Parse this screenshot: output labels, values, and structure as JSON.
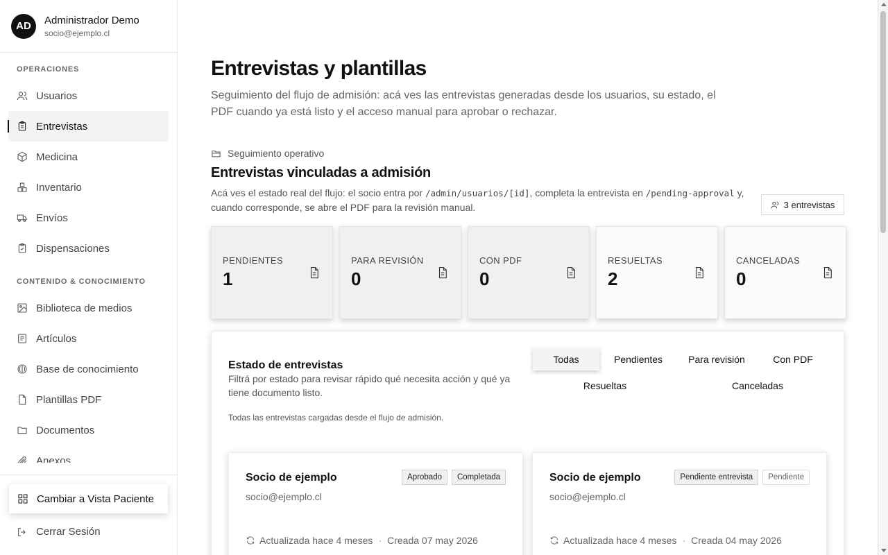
{
  "user": {
    "initials": "AD",
    "name": "Administrador Demo",
    "email": "socio@ejemplo.cl"
  },
  "sidebar": {
    "sections": [
      {
        "title": "OPERACIONES",
        "items": [
          {
            "label": "Usuarios",
            "icon": "users-icon"
          },
          {
            "label": "Entrevistas",
            "icon": "clipboard-icon",
            "active": true
          },
          {
            "label": "Medicina",
            "icon": "package-icon"
          },
          {
            "label": "Inventario",
            "icon": "boxes-icon"
          },
          {
            "label": "Envíos",
            "icon": "truck-icon"
          },
          {
            "label": "Dispensaciones",
            "icon": "clipboard-check-icon"
          }
        ]
      },
      {
        "title": "CONTENIDO & CONOCIMIENTO",
        "items": [
          {
            "label": "Biblioteca de medios",
            "icon": "image-icon"
          },
          {
            "label": "Artículos",
            "icon": "newspaper-icon"
          },
          {
            "label": "Base de conocimiento",
            "icon": "brain-icon"
          },
          {
            "label": "Plantillas PDF",
            "icon": "file-icon"
          },
          {
            "label": "Documentos",
            "icon": "folder-icon"
          },
          {
            "label": "Anexos",
            "icon": "paperclip-icon"
          }
        ]
      }
    ],
    "switch_label": "Cambiar a Vista Paciente",
    "logout_label": "Cerrar Sesión"
  },
  "page": {
    "title": "Entrevistas y plantillas",
    "description": "Seguimiento del flujo de admisión: acá ves las entrevistas generadas desde los usuarios, su estado, el PDF cuando ya está listo y el acceso manual para aprobar o rechazar."
  },
  "section": {
    "kicker": "Seguimiento operativo",
    "title": "Entrevistas vinculadas a admisión",
    "desc_part1": "Acá ves el estado real del flujo: el socio entra por ",
    "desc_code1": "/admin/usuarios/[id]",
    "desc_part2": ", completa la entrevista en ",
    "desc_code2": "/pending-approval",
    "desc_part3": " y, cuando corresponde, se abre el PDF para la revisión manual.",
    "count_label": "3 entrevistas"
  },
  "stats": [
    {
      "label": "PENDIENTES",
      "value": "1"
    },
    {
      "label": "PARA REVISIÓN",
      "value": "0"
    },
    {
      "label": "CON PDF",
      "value": "0"
    },
    {
      "label": "RESUELTAS",
      "value": "2"
    },
    {
      "label": "CANCELADAS",
      "value": "0"
    }
  ],
  "panel": {
    "title": "Estado de entrevistas",
    "description": "Filtrá por estado para revisar rápido qué necesita acción y qué ya tiene documento listo.",
    "note": "Todas las entrevistas cargadas desde el flujo de admisión.",
    "filters": [
      "Todas",
      "Pendientes",
      "Para revisión",
      "Con PDF",
      "Resueltas",
      "Canceladas"
    ],
    "active_filter": "Todas"
  },
  "cards": [
    {
      "name": "Socio de ejemplo",
      "email": "socio@ejemplo.cl",
      "badges": [
        "Aprobado",
        "Completada"
      ],
      "updated": "Actualizada hace 4 meses",
      "created": "Creada 07 may 2026"
    },
    {
      "name": "Socio de ejemplo",
      "email": "socio@ejemplo.cl",
      "badges": [
        "Pendiente entrevista",
        "Pendiente"
      ],
      "updated": "Actualizada hace 4 meses",
      "created": "Creada 04 may 2026"
    }
  ]
}
